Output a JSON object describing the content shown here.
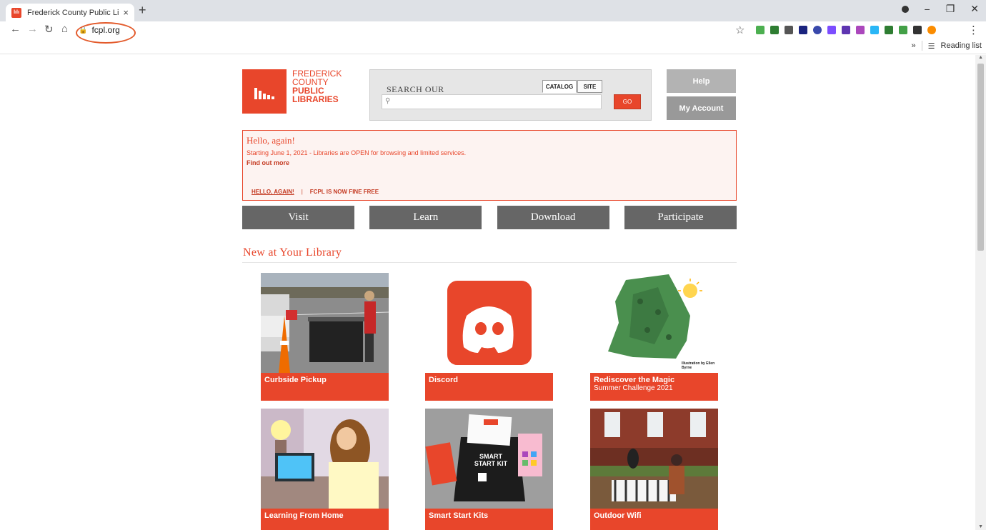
{
  "browser": {
    "tab_title": "Frederick County Public Libraries",
    "tab_close": "×",
    "new_tab": "+",
    "url": "fcpl.org",
    "reading_list": "Reading list",
    "more_bookmarks": "»",
    "window_controls": [
      "−",
      "❐",
      "✕"
    ]
  },
  "logo": {
    "line1": "FREDERICK",
    "line2": "COUNTY",
    "line3": "PUBLIC",
    "line4": "LIBRARIES"
  },
  "search": {
    "label": "SEARCH OUR",
    "tabs": [
      "CATALOG",
      "SITE"
    ],
    "placeholder": "",
    "go_label": "GO"
  },
  "side_buttons": {
    "help": "Help",
    "account": "My Account"
  },
  "alert": {
    "title": "Hello, again!",
    "body": "Starting June 1, 2021 - Libraries are OPEN for browsing and limited services.",
    "link": "Find out more",
    "tabs": [
      "HELLO, AGAIN!",
      "FCPL IS NOW FINE FREE"
    ],
    "separator": "|"
  },
  "nav": [
    "Visit",
    "Learn",
    "Download",
    "Participate"
  ],
  "section_title": "New at Your Library",
  "cards": [
    {
      "title": "Curbside Pickup",
      "subtitle": ""
    },
    {
      "title": "Discord",
      "subtitle": ""
    },
    {
      "title": "Rediscover the Magic",
      "subtitle": "Summer Challenge 2021",
      "illustration_credit": "Illustration by Ellen Byrne"
    },
    {
      "title": "Learning From Home",
      "subtitle": ""
    },
    {
      "title": "Smart Start Kits",
      "subtitle": "",
      "kit_text": "SMART START KIT"
    },
    {
      "title": "Outdoor Wifi",
      "subtitle": ""
    }
  ],
  "colors": {
    "brand": "#e8462b",
    "nav_bg": "#666666",
    "side_button": "#b3b3b3"
  }
}
